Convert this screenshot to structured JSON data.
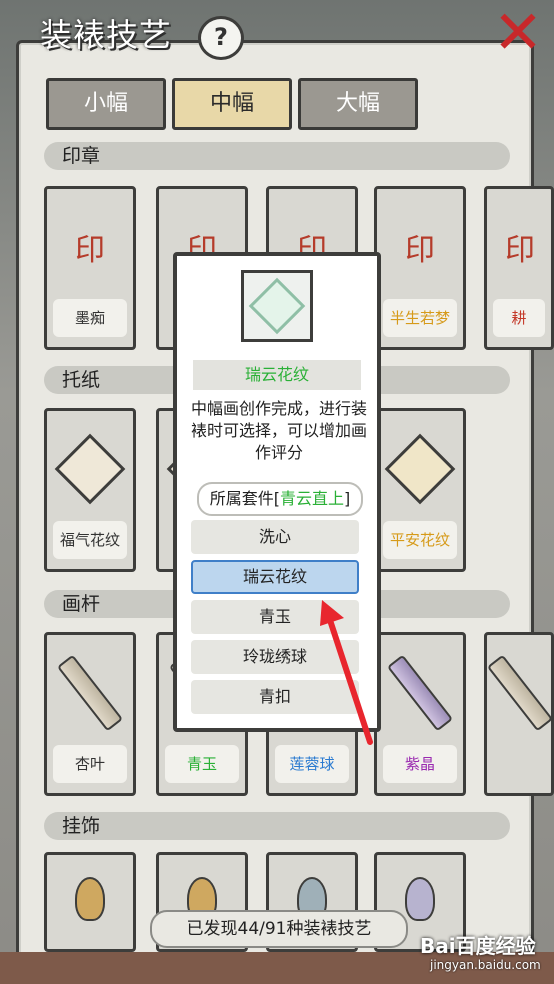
{
  "title": "装裱技艺",
  "help_icon": "question-icon",
  "close_icon": "close-x-icon",
  "size_tabs": [
    {
      "label": "小幅",
      "active": false
    },
    {
      "label": "中幅",
      "active": true
    },
    {
      "label": "大幅",
      "active": false
    }
  ],
  "sections": {
    "seal": "印章",
    "paper": "托纸",
    "rod": "画杆",
    "pendant": "挂饰"
  },
  "seal_cards": [
    {
      "label": "墨痴",
      "color": "#333333"
    },
    {
      "label": "",
      "color": "#333333"
    },
    {
      "label": "",
      "color": "#333333"
    },
    {
      "label": "半生若梦",
      "color": "#d69a1a"
    },
    {
      "label": "耕",
      "color": "#c43a2a"
    }
  ],
  "paper_cards": [
    {
      "label": "福气花纹",
      "color": "#333333"
    },
    {
      "label": "",
      "color": "#333333"
    },
    {
      "label": "平安花纹",
      "color": "#d69a1a"
    }
  ],
  "rod_cards": [
    {
      "label": "杏叶",
      "color": "#333333"
    },
    {
      "label": "青玉",
      "color": "#2ab036"
    },
    {
      "label": "莲蓉球",
      "color": "#2a7ad0"
    },
    {
      "label": "紫晶",
      "color": "#9a2ab0"
    }
  ],
  "footer": "已发现44/91种装裱技艺",
  "popup": {
    "name": "瑞云花纹",
    "description": "中幅画创作完成，进行装裱时可选择，可以增加画作评分",
    "set_prefix": "所属套件[",
    "set_name": "青云直上",
    "set_suffix": "]",
    "options": [
      {
        "label": "洗心",
        "selected": false
      },
      {
        "label": "瑞云花纹",
        "selected": true
      },
      {
        "label": "青玉",
        "selected": false
      },
      {
        "label": "玲珑绣球",
        "selected": false
      },
      {
        "label": "青扣",
        "selected": false
      }
    ]
  },
  "watermark": {
    "brand": "Bai百度经验",
    "url": "jingyan.baidu.com"
  },
  "colors": {
    "accent_red": "#e8262e",
    "rare_green": "#2ab036",
    "selected_blue": "#bcd6ee"
  }
}
